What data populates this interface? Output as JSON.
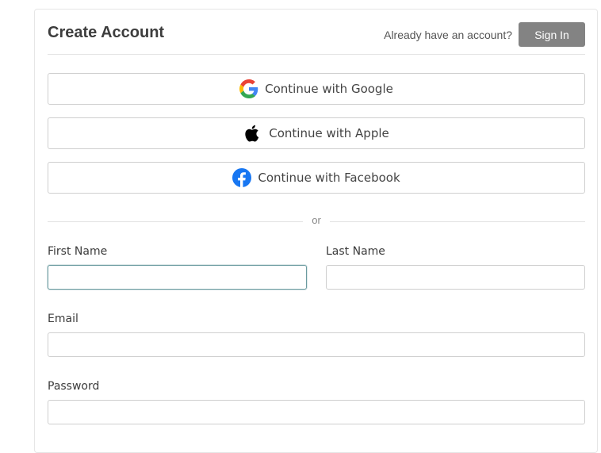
{
  "header": {
    "title": "Create Account",
    "have_account": "Already have an account?",
    "signin_label": "Sign In"
  },
  "social": {
    "google_label": "Continue with Google",
    "apple_label": "Continue with Apple",
    "facebook_label": "Continue with Facebook"
  },
  "divider": {
    "text": "or"
  },
  "form": {
    "first_name_label": "First Name",
    "first_name_value": "",
    "last_name_label": "Last Name",
    "last_name_value": "",
    "email_label": "Email",
    "email_value": "",
    "password_label": "Password",
    "password_value": ""
  },
  "colors": {
    "signin_bg": "#838383",
    "focus_border": "#6b9ba0",
    "facebook_blue": "#1877F2"
  }
}
